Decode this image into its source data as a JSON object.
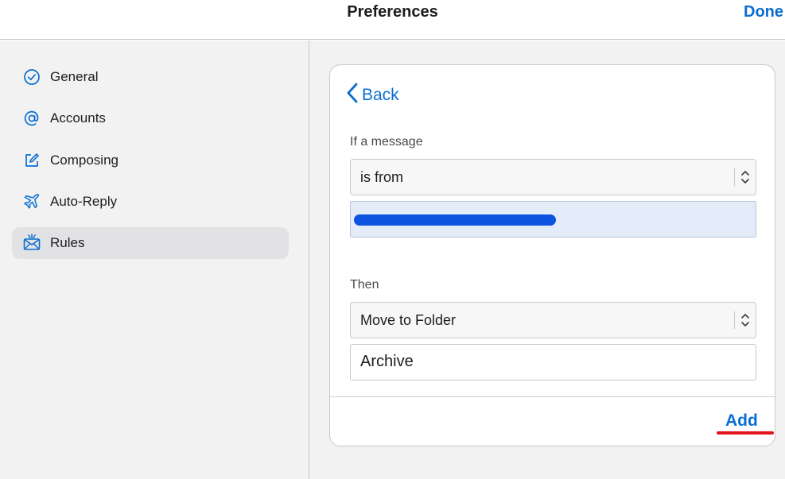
{
  "header": {
    "title": "Preferences",
    "done_label": "Done"
  },
  "sidebar": {
    "items": [
      {
        "label": "General",
        "icon": "checkmark-circle-icon"
      },
      {
        "label": "Accounts",
        "icon": "at-sign-icon"
      },
      {
        "label": "Composing",
        "icon": "compose-icon"
      },
      {
        "label": "Auto-Reply",
        "icon": "airplane-icon"
      },
      {
        "label": "Rules",
        "icon": "envelope-rules-icon",
        "selected": true
      }
    ]
  },
  "rule_editor": {
    "back_label": "Back",
    "condition_label": "If a message",
    "condition_value": "is from",
    "action_label": "Then",
    "action_value": "Move to Folder",
    "folder_value": "Archive",
    "add_label": "Add"
  },
  "colors": {
    "accent": "#0a6ed1",
    "sidebar_bg": "#f2f2f2",
    "selected_bg": "#e2e2e4",
    "redaction": "#0b53e0",
    "annotation": "#e2141b"
  }
}
